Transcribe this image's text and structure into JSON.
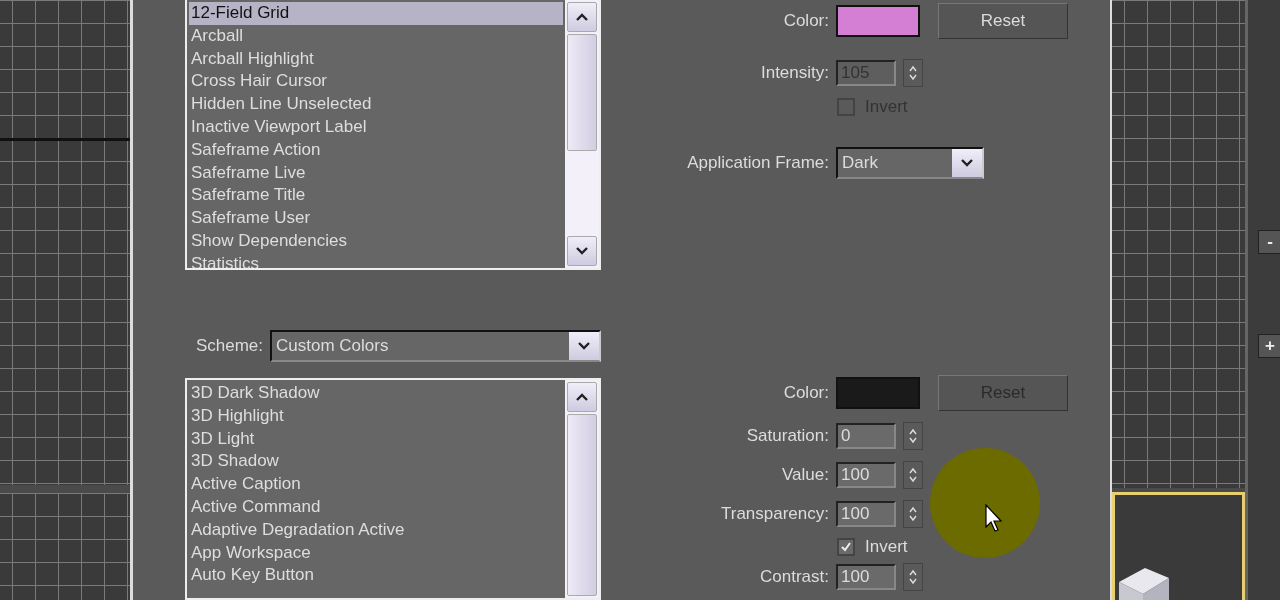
{
  "element_list": {
    "items": [
      {
        "label": "12-Field Grid",
        "selected": true
      },
      {
        "label": "Arcball",
        "selected": false
      },
      {
        "label": "Arcball Highlight",
        "selected": false
      },
      {
        "label": "Cross Hair Cursor",
        "selected": false
      },
      {
        "label": "Hidden Line Unselected",
        "selected": false
      },
      {
        "label": "Inactive Viewport Label",
        "selected": false
      },
      {
        "label": "Safeframe Action",
        "selected": false
      },
      {
        "label": "Safeframe Live",
        "selected": false
      },
      {
        "label": "Safeframe Title",
        "selected": false
      },
      {
        "label": "Safeframe User",
        "selected": false
      },
      {
        "label": "Show Dependencies",
        "selected": false
      },
      {
        "label": "Statistics",
        "selected": false
      }
    ]
  },
  "element_settings": {
    "color_label": "Color:",
    "color": "#d47fd4",
    "reset": "Reset",
    "intensity_label": "Intensity:",
    "intensity": "105",
    "invert": {
      "label": "Invert",
      "checked": false
    },
    "frame_label": "Application Frame:",
    "frame_value": "Dark"
  },
  "scheme": {
    "label": "Scheme:",
    "value": "Custom Colors"
  },
  "scheme_list": {
    "items": [
      {
        "label": "3D Dark Shadow",
        "selected": false
      },
      {
        "label": "3D Highlight",
        "selected": false
      },
      {
        "label": "3D Light",
        "selected": false
      },
      {
        "label": "3D Shadow",
        "selected": false
      },
      {
        "label": "Active Caption",
        "selected": false
      },
      {
        "label": "Active Command",
        "selected": false
      },
      {
        "label": "Adaptive Degradation Active",
        "selected": false
      },
      {
        "label": "App Workspace",
        "selected": false
      },
      {
        "label": "Auto Key Button",
        "selected": false
      }
    ]
  },
  "scheme_settings": {
    "color_label": "Color:",
    "color": "#1a1a1a",
    "reset": "Reset",
    "spinners": [
      {
        "label": "Saturation:",
        "value": "0"
      },
      {
        "label": "Value:",
        "value": "100"
      },
      {
        "label": "Transparency:",
        "value": "100"
      }
    ],
    "invert": {
      "label": "Invert",
      "checked": true
    },
    "contrast": {
      "label": "Contrast:",
      "value": "100"
    }
  },
  "side_toolbar": {
    "buttons": [
      "-",
      "+"
    ]
  }
}
